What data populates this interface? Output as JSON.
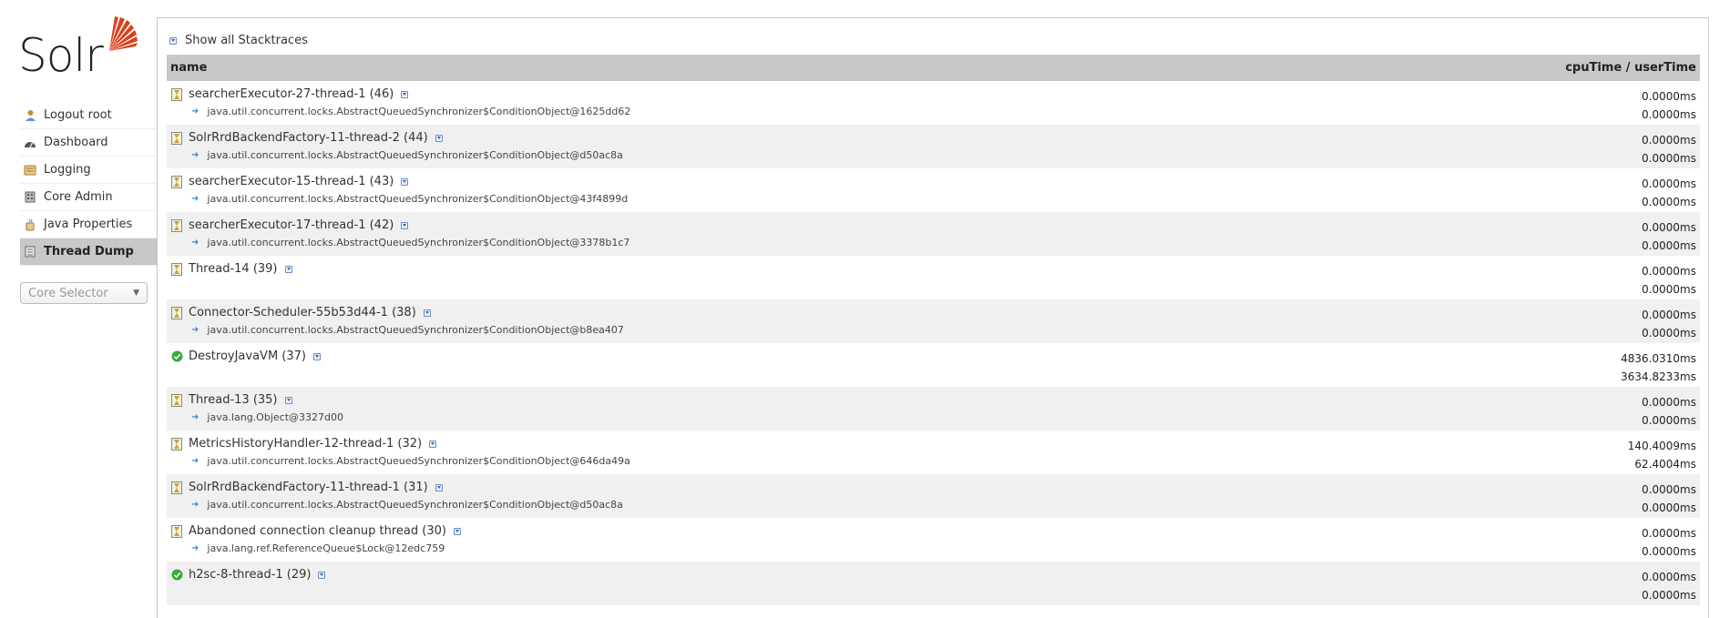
{
  "logo": {
    "wordmark": "Solr"
  },
  "nav": [
    {
      "label": "Logout root",
      "icon": "user-icon"
    },
    {
      "label": "Dashboard",
      "icon": "dashboard-icon"
    },
    {
      "label": "Logging",
      "icon": "logging-icon"
    },
    {
      "label": "Core Admin",
      "icon": "core-admin-icon"
    },
    {
      "label": "Java Properties",
      "icon": "java-icon"
    },
    {
      "label": "Thread Dump",
      "icon": "thread-dump-icon",
      "active": true
    }
  ],
  "core_selector": {
    "placeholder": "Core Selector"
  },
  "main": {
    "toggle_all_label": "Show all Stacktraces",
    "columns": {
      "name": "name",
      "time": "cpuTime / userTime"
    },
    "threads": [
      {
        "name": "searcherExecutor-27-thread-1 (46)",
        "state": "waiting",
        "lock": "java.util.concurrent.locks.AbstractQueuedSynchronizer$ConditionObject@1625dd62",
        "cpu": "0.0000ms",
        "user": "0.0000ms"
      },
      {
        "name": "SolrRrdBackendFactory-11-thread-2 (44)",
        "state": "waiting",
        "lock": "java.util.concurrent.locks.AbstractQueuedSynchronizer$ConditionObject@d50ac8a",
        "cpu": "0.0000ms",
        "user": "0.0000ms"
      },
      {
        "name": "searcherExecutor-15-thread-1 (43)",
        "state": "waiting",
        "lock": "java.util.concurrent.locks.AbstractQueuedSynchronizer$ConditionObject@43f4899d",
        "cpu": "0.0000ms",
        "user": "0.0000ms"
      },
      {
        "name": "searcherExecutor-17-thread-1 (42)",
        "state": "waiting",
        "lock": "java.util.concurrent.locks.AbstractQueuedSynchronizer$ConditionObject@3378b1c7",
        "cpu": "0.0000ms",
        "user": "0.0000ms"
      },
      {
        "name": "Thread-14 (39)",
        "state": "timed-waiting",
        "lock": "",
        "cpu": "0.0000ms",
        "user": "0.0000ms"
      },
      {
        "name": "Connector-Scheduler-55b53d44-1 (38)",
        "state": "waiting",
        "lock": "java.util.concurrent.locks.AbstractQueuedSynchronizer$ConditionObject@b8ea407",
        "cpu": "0.0000ms",
        "user": "0.0000ms"
      },
      {
        "name": "DestroyJavaVM (37)",
        "state": "runnable",
        "lock": "",
        "cpu": "4836.0310ms",
        "user": "3634.8233ms"
      },
      {
        "name": "Thread-13 (35)",
        "state": "waiting",
        "lock": "java.lang.Object@3327d00",
        "cpu": "0.0000ms",
        "user": "0.0000ms"
      },
      {
        "name": "MetricsHistoryHandler-12-thread-1 (32)",
        "state": "waiting",
        "lock": "java.util.concurrent.locks.AbstractQueuedSynchronizer$ConditionObject@646da49a",
        "cpu": "140.4009ms",
        "user": "62.4004ms"
      },
      {
        "name": "SolrRrdBackendFactory-11-thread-1 (31)",
        "state": "waiting",
        "lock": "java.util.concurrent.locks.AbstractQueuedSynchronizer$ConditionObject@d50ac8a",
        "cpu": "0.0000ms",
        "user": "0.0000ms"
      },
      {
        "name": "Abandoned connection cleanup thread (30)",
        "state": "timed-waiting",
        "lock": "java.lang.ref.ReferenceQueue$Lock@12edc759",
        "cpu": "0.0000ms",
        "user": "0.0000ms"
      },
      {
        "name": "h2sc-8-thread-1 (29)",
        "state": "runnable",
        "lock": "",
        "cpu": "0.0000ms",
        "user": "0.0000ms"
      }
    ]
  },
  "colors": {
    "accent": "#d9411e",
    "header_bg": "#c8c8c8",
    "alt_row": "#f0f0f0",
    "runnable": "#3aaa35"
  }
}
